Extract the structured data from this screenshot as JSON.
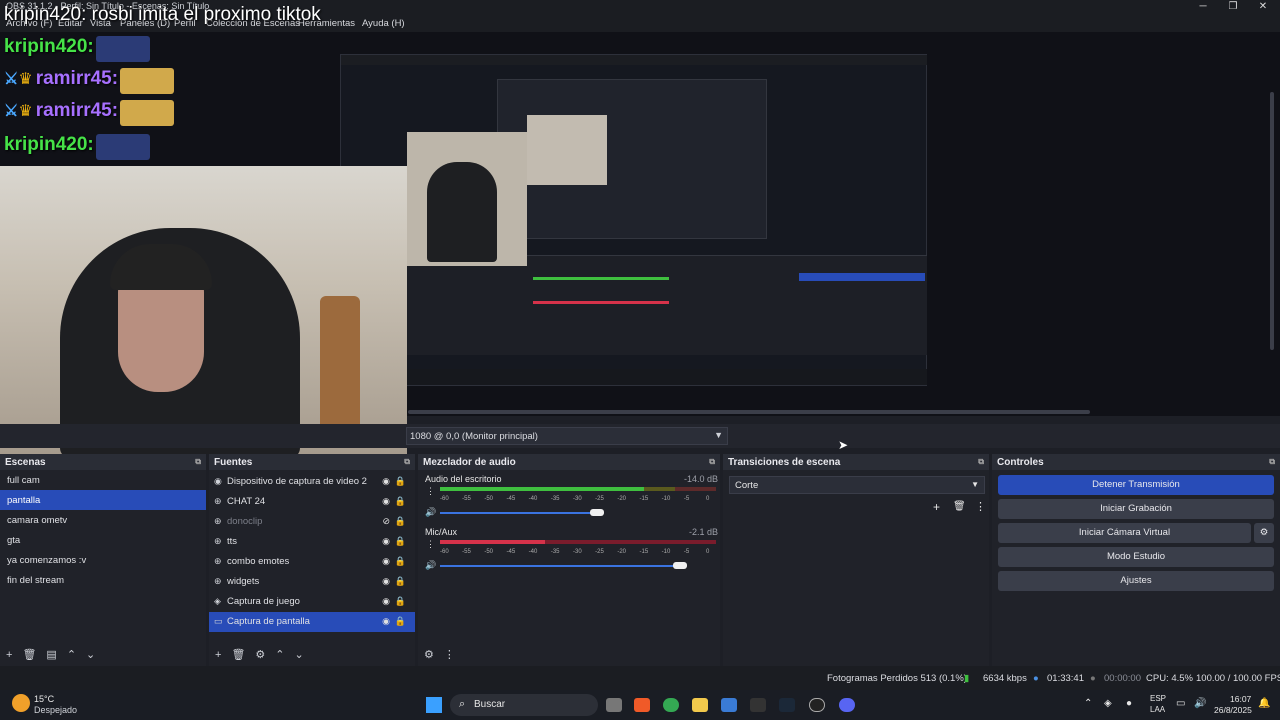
{
  "window": {
    "title": "OBS 31.1.2 - Perfil: Sin Título - Escenas: Sin Título"
  },
  "menu": [
    "Archivo (F)",
    "Editar",
    "Vista",
    "Paneles (D)",
    "Perfil",
    "Colección de Escenas",
    "Herramientas",
    "Ayuda (H)"
  ],
  "overlay": {
    "title_line": "kripin420: rosbi imita el proximo tiktok",
    "chat": [
      {
        "name": "kripin420:",
        "color": "green",
        "badges": []
      },
      {
        "name": "ramirr45:",
        "color": "purple",
        "badges": [
          "sword",
          "crown"
        ]
      },
      {
        "name": "ramirr45:",
        "color": "purple",
        "badges": [
          "sword",
          "crown"
        ]
      },
      {
        "name": "kripin420:",
        "color": "green",
        "badges": []
      }
    ]
  },
  "preview": {
    "monitor_select": "1080 @ 0,0 (Monitor principal)"
  },
  "docks": {
    "scenes": {
      "title": "Escenas",
      "items": [
        "full cam",
        "pantalla",
        "camara ometv",
        "gta",
        "ya comenzamos :v",
        "fin del stream"
      ],
      "selected": 1
    },
    "sources": {
      "title": "Fuentes",
      "items": [
        {
          "label": "Dispositivo de captura de video 2",
          "icon": "camera-icon",
          "visible": true
        },
        {
          "label": "CHAT 24",
          "icon": "globe-icon",
          "visible": true
        },
        {
          "label": "donoclip",
          "icon": "globe-icon",
          "visible": false
        },
        {
          "label": "tts",
          "icon": "globe-icon",
          "visible": true
        },
        {
          "label": "combo emotes",
          "icon": "globe-icon",
          "visible": true
        },
        {
          "label": "widgets",
          "icon": "globe-icon",
          "visible": true
        },
        {
          "label": "Captura de juego",
          "icon": "gamepad-icon",
          "visible": true
        },
        {
          "label": "Captura de pantalla",
          "icon": "monitor-icon",
          "visible": true
        }
      ],
      "selected": 7
    },
    "audio": {
      "title": "Mezclador de audio",
      "channels": [
        {
          "name": "Audio del escritorio",
          "db": "-14.0 dB",
          "level": 0.74,
          "volume": 0.57
        },
        {
          "name": "Mic/Aux",
          "db": "-2.1 dB",
          "level": 0.38,
          "volume": 0.87
        }
      ],
      "scale": [
        "-60",
        "-55",
        "-50",
        "-45",
        "-40",
        "-35",
        "-30",
        "-25",
        "-20",
        "-15",
        "-10",
        "-5",
        "0"
      ]
    },
    "transitions": {
      "title": "Transiciones de escena",
      "selected": "Corte"
    },
    "controls": {
      "title": "Controles",
      "buttons": [
        "Detener Transmisión",
        "Iniciar Grabación",
        "Iniciar Cámara Virtual",
        "Modo Estudio",
        "Ajustes"
      ]
    }
  },
  "status": {
    "dropped": "Fotogramas Perdidos 513 (0.1%)",
    "kbps": "6634 kbps",
    "live_time": "01:33:41",
    "rec_time": "00:00:00",
    "cpu": "CPU: 4.5%",
    "fps": "100.00 / 100.00 FPS"
  },
  "taskbar": {
    "weather_temp": "15°C",
    "weather_desc": "Despejado",
    "search": "Buscar",
    "lang1": "ESP",
    "lang2": "LAA",
    "time": "16:07",
    "date": "26/8/2025"
  },
  "colors": {
    "accent": "#284cb8",
    "meter_green": "#3fbf3f",
    "meter_red": "#d6324a",
    "meter_yellow": "#c9b536"
  }
}
